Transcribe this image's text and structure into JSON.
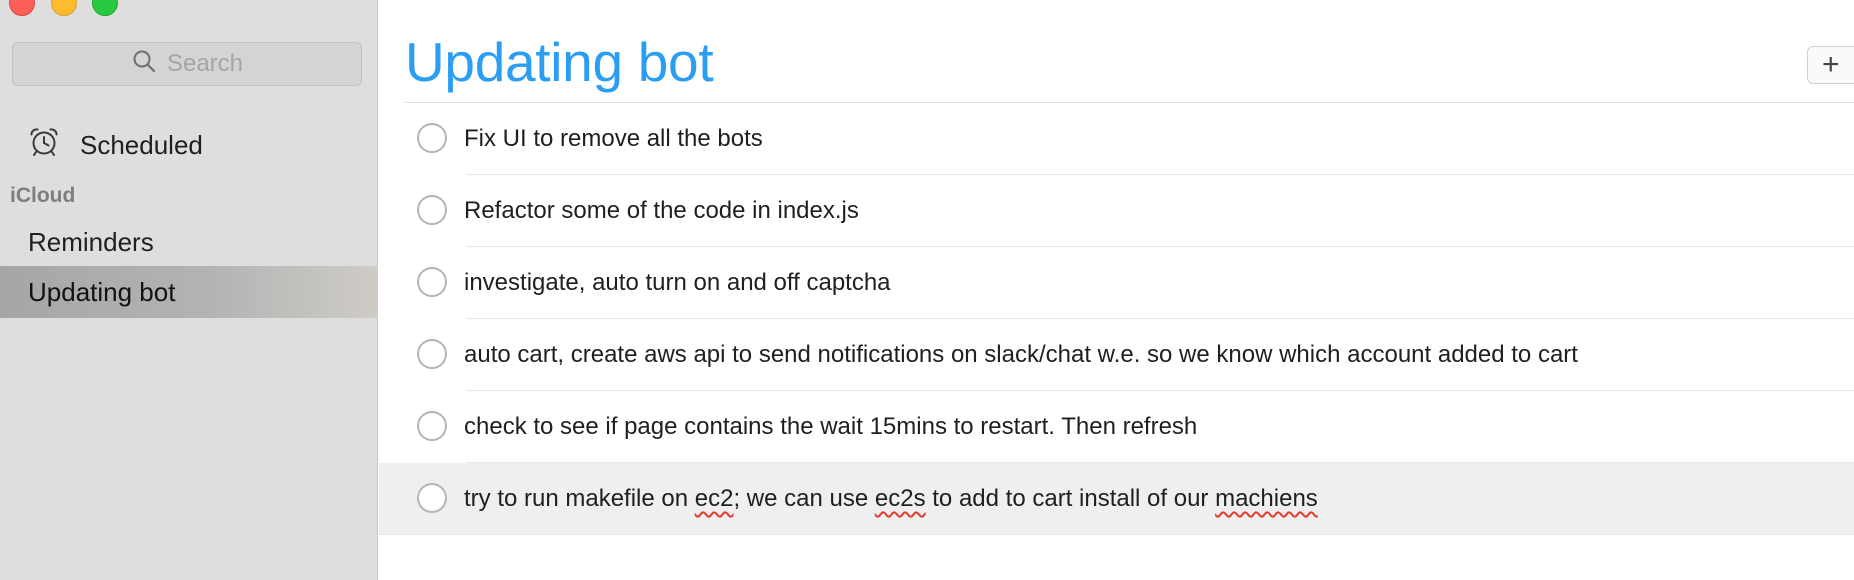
{
  "window": {
    "controls": [
      "close",
      "minimize",
      "maximize"
    ]
  },
  "sidebar": {
    "search": {
      "placeholder": "Search",
      "icon": "magnifier"
    },
    "scheduled": {
      "label": "Scheduled",
      "icon": "alarm-clock"
    },
    "section": "iCloud",
    "lists": [
      {
        "label": "Reminders"
      },
      {
        "label": "Updating bot",
        "selected": true
      }
    ]
  },
  "main": {
    "title": "Updating bot",
    "add_button": "+",
    "tasks": [
      {
        "parts": [
          "Fix UI to remove all the bots"
        ]
      },
      {
        "parts": [
          "Refactor some of the code in index.js"
        ]
      },
      {
        "parts": [
          "investigate, auto turn on and off captcha"
        ]
      },
      {
        "parts": [
          "auto cart, create aws api to send notifications on slack/chat w.e. so we know which account added to cart"
        ]
      },
      {
        "parts": [
          "check to see if page contains the wait 15mins to restart. Then refresh"
        ]
      },
      {
        "parts": [
          "try to run makefile on ",
          "ec2",
          "; we can use ",
          "ec2s",
          " to add to cart install of our ",
          "machiens"
        ],
        "highlighted": true
      }
    ]
  },
  "colors": {
    "title_blue": "#2b9ef3",
    "sidebar_bg": "#dedede",
    "selected_row": "#b3b3b3",
    "spellcheck": "#e23b2e"
  }
}
